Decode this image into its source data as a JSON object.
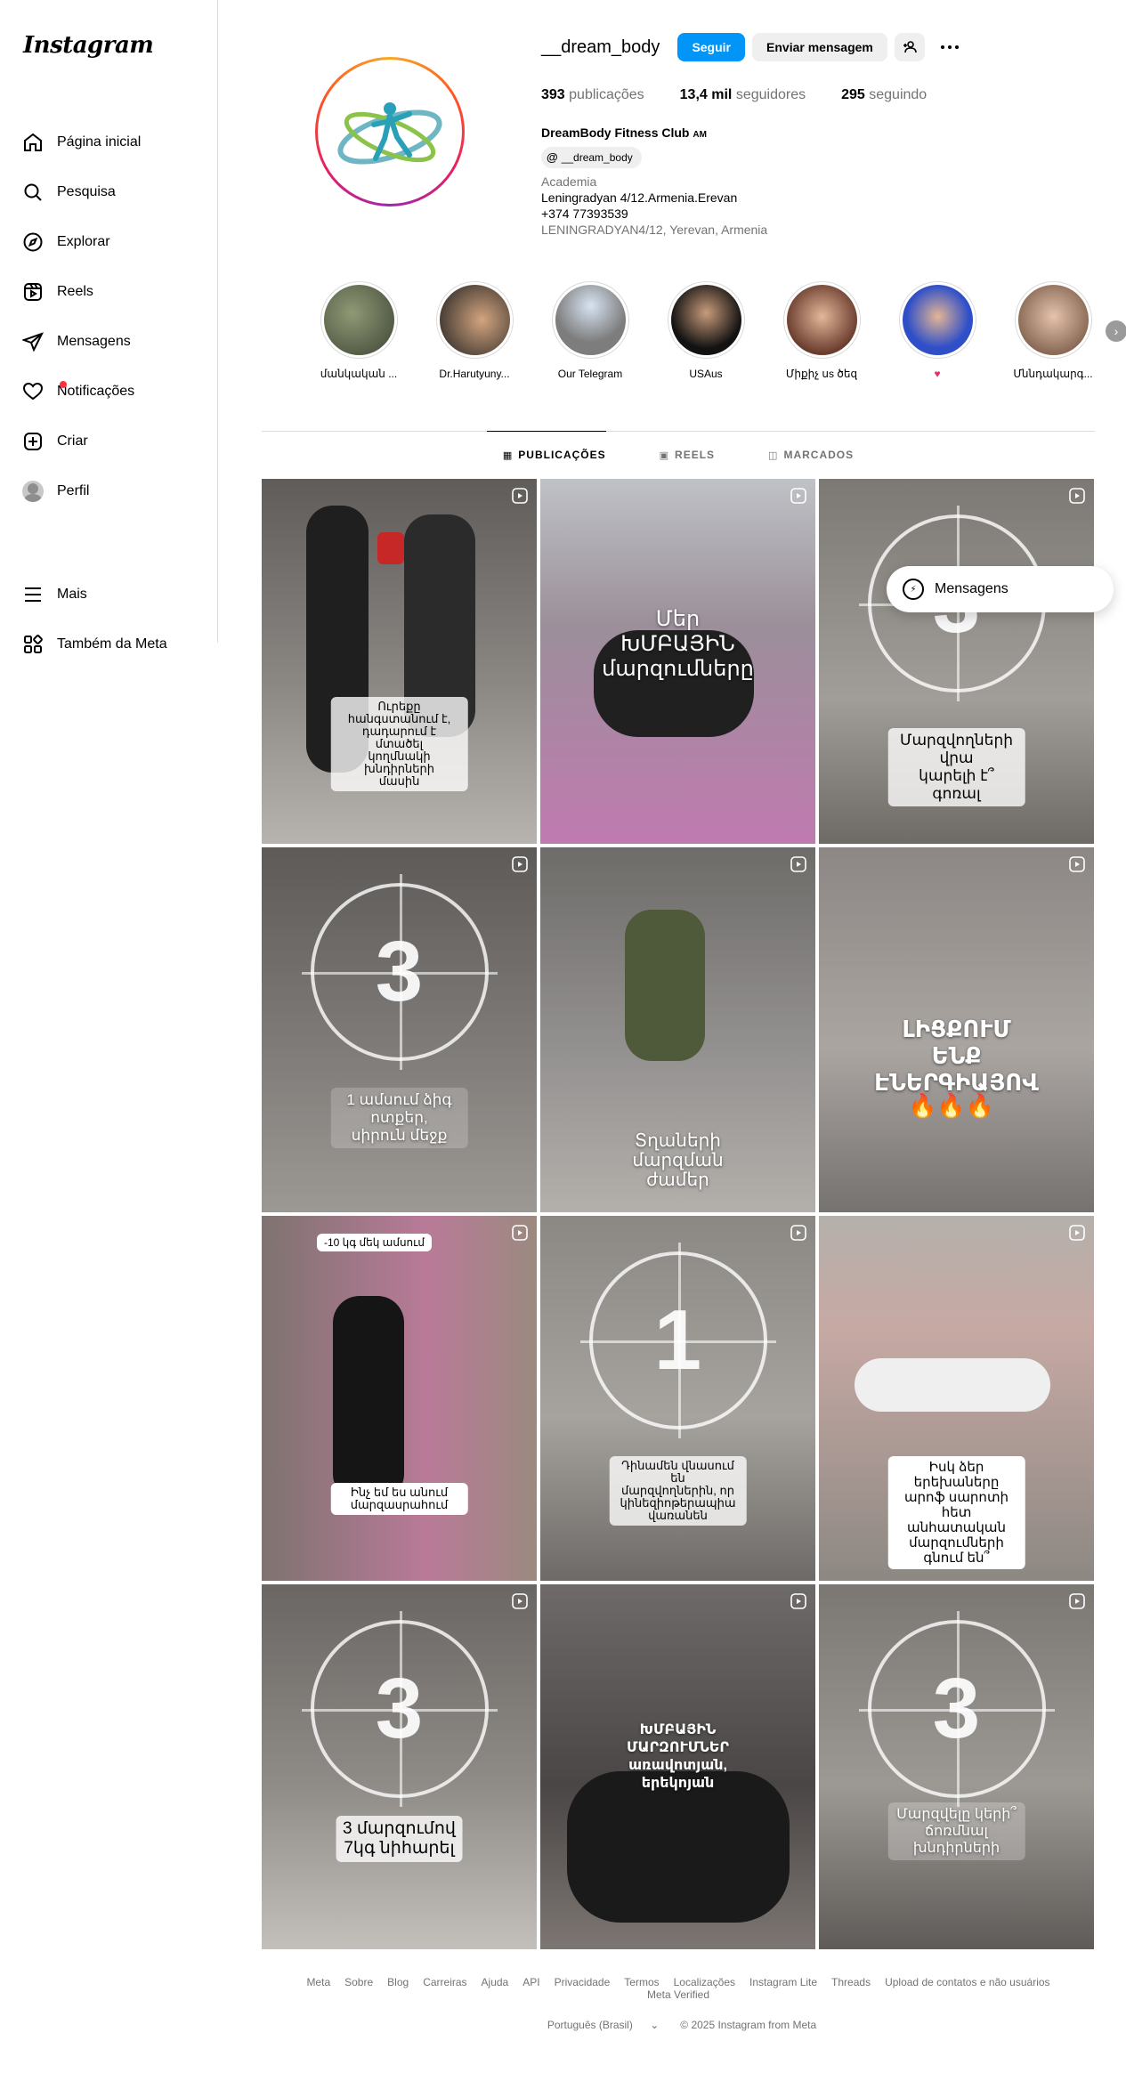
{
  "app": {
    "logo": "Instagram"
  },
  "sidebar": {
    "items": [
      {
        "label": "Página inicial",
        "icon": "home-icon"
      },
      {
        "label": "Pesquisa",
        "icon": "search-icon"
      },
      {
        "label": "Explorar",
        "icon": "compass-icon"
      },
      {
        "label": "Reels",
        "icon": "reels-icon"
      },
      {
        "label": "Mensagens",
        "icon": "send-icon"
      },
      {
        "label": "Notificações",
        "icon": "heart-icon"
      },
      {
        "label": "Criar",
        "icon": "plus-square-icon"
      },
      {
        "label": "Perfil",
        "icon": "avatar"
      }
    ],
    "bottom": [
      {
        "label": "Mais",
        "icon": "menu-icon"
      },
      {
        "label": "Também da Meta",
        "icon": "meta-apps-icon"
      }
    ]
  },
  "profile": {
    "username": "__dream_body",
    "follow_label": "Seguir",
    "message_label": "Enviar mensagem",
    "stats": {
      "posts_count": "393",
      "posts_label": "publicações",
      "followers_count": "13,4 mil",
      "followers_label": "seguidores",
      "following_count": "295",
      "following_label": "seguindo"
    },
    "name": "DreamBody Fitness Club",
    "country_code": "AM",
    "threads_handle": "__dream_body",
    "category": "Academia",
    "bio_line1": "Leningradyan 4/12.Armenia.Erevan",
    "bio_line2": "+374 77393539",
    "address": "LENINGRADYAN4/12, Yerevan, Armenia"
  },
  "highlights": [
    {
      "label": "մանկական ...",
      "color": "#5b6b4a"
    },
    {
      "label": "Dr.Harutyuny...",
      "color": "#2b2b2b"
    },
    {
      "label": "Our Telegram",
      "color": "#8a8a8a"
    },
    {
      "label": "USAus",
      "color": "#1e1e1e"
    },
    {
      "label": "Միքիչ սs ծեզ",
      "color": "#b07860"
    },
    {
      "label": "♥",
      "color": "#3a5bd6"
    },
    {
      "label": "Մննդակարգ...",
      "color": "#c19a7d"
    }
  ],
  "tabs": [
    {
      "label": "PUBLICAÇÕES",
      "icon": "grid-icon",
      "active": true
    },
    {
      "label": "REELS",
      "icon": "reels-icon",
      "active": false
    },
    {
      "label": "MARCADOS",
      "icon": "tag-icon",
      "active": false
    }
  ],
  "posts": [
    {
      "text": "Ուրեքը հանգստանում է,\nդադարում է մտածել\nկողմնակի խնդիրների\nմասին",
      "style": "light",
      "bg": "#6e6a66",
      "countdown": ""
    },
    {
      "text": "Մեր\nԽՄԲԱՅԻՆ\nմարզումները",
      "style": "white",
      "bg": "#a8a0a8",
      "countdown": ""
    },
    {
      "text": "Մարզվողների վրա\nկարելի է՞ գոռալ",
      "style": "light",
      "bg": "#8d8a84",
      "countdown": "3"
    },
    {
      "text": "1 ամսում ձիգ ոտքեր,\nսիրուն մեջք",
      "style": "white",
      "bg": "#6d6a68",
      "countdown": "3"
    },
    {
      "text": "Տղաների մարզման\nժամեր",
      "style": "white",
      "bg": "#7c7a77",
      "countdown": ""
    },
    {
      "text": "ԼԻՑՔՈՒՄ ԵՆՔ\nԷՆԵՐԳԻԱՅՈՎ",
      "style": "white",
      "bg": "#9a938f",
      "countdown": ""
    },
    {
      "text": "Ինչ եմ ես անում մարզասրահում",
      "style": "light",
      "bg": "#8a7068",
      "countdown": ""
    },
    {
      "text": "Դինամեն վնասում են\nմարզվողներին, որ\nկինեզիոթերապիա վառանեն",
      "style": "light",
      "bg": "#8c8985",
      "countdown": "1"
    },
    {
      "text": "Իսկ ձեր երեխաները\nարոֆ սարոտի հետ\nանհատական\nմարզումների գնում են՞",
      "style": "light",
      "bg": "#a7a29c",
      "countdown": ""
    },
    {
      "text": "3 մարզումով\n7կգ նիհարել",
      "style": "light",
      "bg": "#77726e",
      "countdown": "3"
    },
    {
      "text": "ԽՄԲԱՅԻՆ ՄԱՐԶՈՒՄՆԵՐ\nառավոտյան,\nերեկոյան",
      "style": "white",
      "bg": "#5d5856",
      "countdown": ""
    },
    {
      "text": "Մարզվելը կերի՞\nճոռմնալ խնդիրների",
      "style": "light",
      "bg": "#7e7a76",
      "countdown": "3"
    }
  ],
  "post_badge": "-10 կգ մեկ ամսում",
  "messages_pill": "Mensagens",
  "footer": {
    "links": [
      "Meta",
      "Sobre",
      "Blog",
      "Carreiras",
      "Ajuda",
      "API",
      "Privacidade",
      "Termos",
      "Localizações",
      "Instagram Lite",
      "Threads",
      "Upload de contatos e não usuários",
      "Meta Verified"
    ],
    "language": "Português (Brasil)",
    "copyright": "© 2025 Instagram from Meta"
  }
}
